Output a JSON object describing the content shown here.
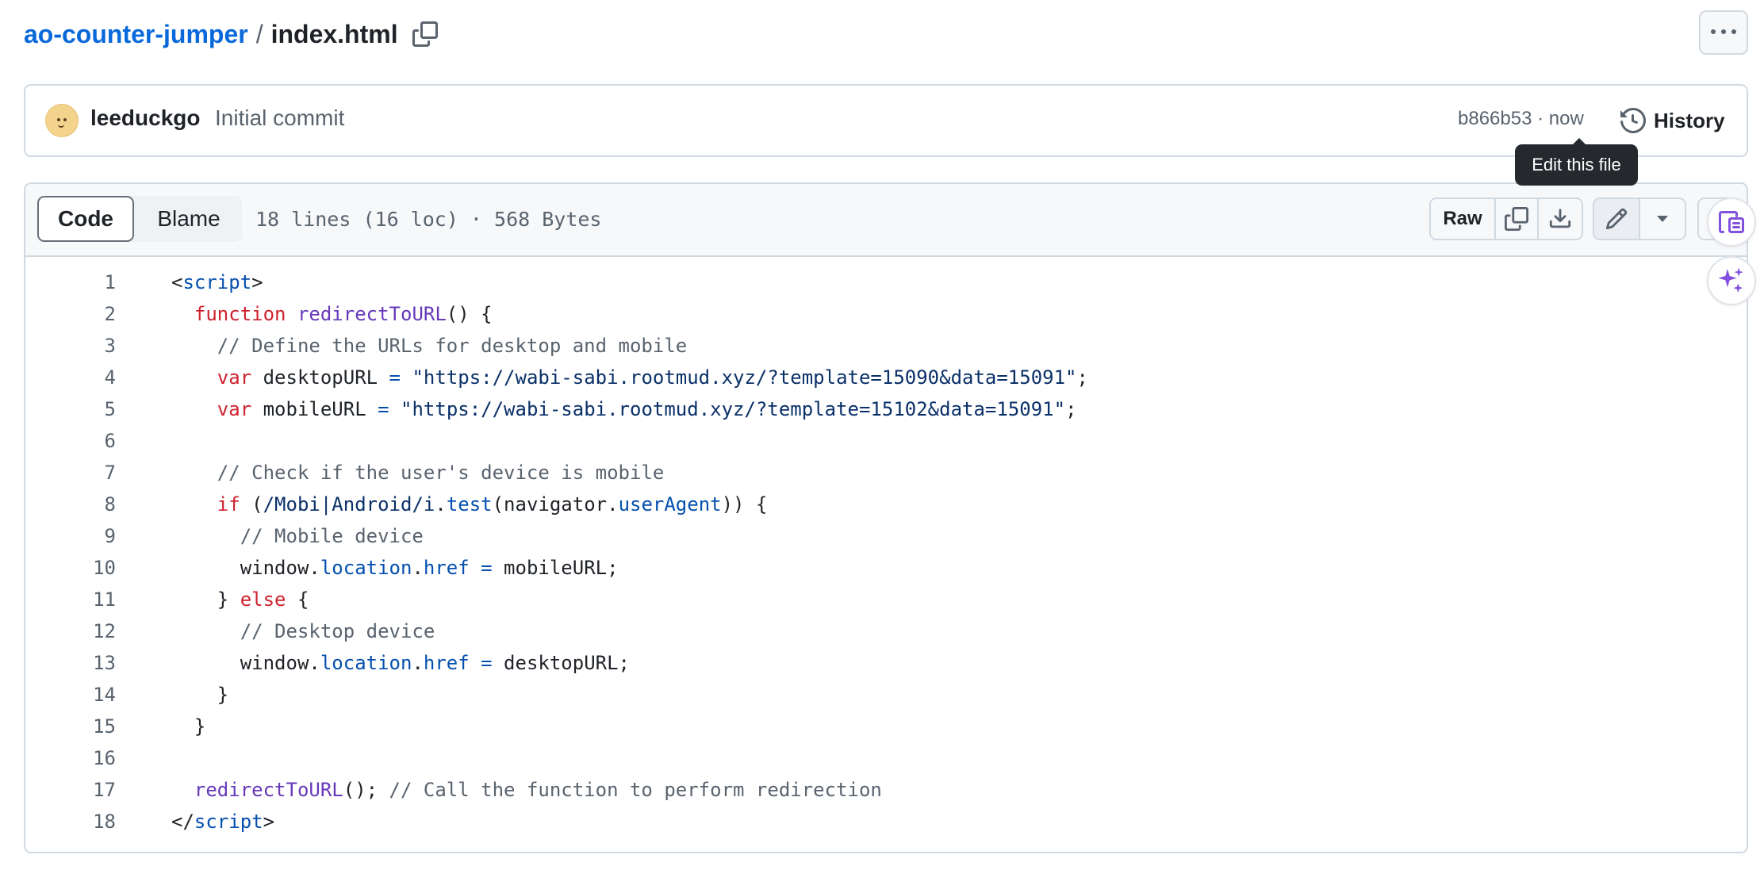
{
  "breadcrumb": {
    "repo": "ao-counter-jumper",
    "separator": "/",
    "file": "index.html"
  },
  "commit": {
    "author": "leeduckgo",
    "message": "Initial commit",
    "sha_time": "b866b53 · now",
    "history_label": "History"
  },
  "tooltip": "Edit this file",
  "file_header": {
    "tab_code": "Code",
    "tab_blame": "Blame",
    "info": "18 lines (16 loc) · 568 Bytes",
    "raw_label": "Raw"
  },
  "icons": [
    "copy-path-icon",
    "kebab-icon",
    "history-icon",
    "copy-icon",
    "download-icon",
    "pencil-icon",
    "caret-down-icon",
    "symbols-icon",
    "copilot-icon"
  ],
  "colors": {
    "link": "#0969da",
    "keyword": "#cf222e",
    "function": "#6639ba",
    "string": "#0a3069",
    "comment": "#59636e",
    "property": "#0550ae",
    "tooltip_bg": "#25292e"
  },
  "code_lines": [
    [
      {
        "t": "<",
        "c": "plain"
      },
      {
        "t": "script",
        "c": "prop"
      },
      {
        "t": ">",
        "c": "plain"
      }
    ],
    [
      {
        "t": "  ",
        "c": "plain"
      },
      {
        "t": "function",
        "c": "kw"
      },
      {
        "t": " ",
        "c": "plain"
      },
      {
        "t": "redirectToURL",
        "c": "fn"
      },
      {
        "t": "() {",
        "c": "plain"
      }
    ],
    [
      {
        "t": "    // Define the URLs for desktop and mobile",
        "c": "com"
      }
    ],
    [
      {
        "t": "    ",
        "c": "plain"
      },
      {
        "t": "var",
        "c": "kw"
      },
      {
        "t": " desktopURL ",
        "c": "plain"
      },
      {
        "t": "=",
        "c": "op"
      },
      {
        "t": " ",
        "c": "plain"
      },
      {
        "t": "\"https://wabi-sabi.rootmud.xyz/?template=15090&data=15091\"",
        "c": "str"
      },
      {
        "t": ";",
        "c": "plain"
      }
    ],
    [
      {
        "t": "    ",
        "c": "plain"
      },
      {
        "t": "var",
        "c": "kw"
      },
      {
        "t": " mobileURL ",
        "c": "plain"
      },
      {
        "t": "=",
        "c": "op"
      },
      {
        "t": " ",
        "c": "plain"
      },
      {
        "t": "\"https://wabi-sabi.rootmud.xyz/?template=15102&data=15091\"",
        "c": "str"
      },
      {
        "t": ";",
        "c": "plain"
      }
    ],
    [],
    [
      {
        "t": "    // Check if the user's device is mobile",
        "c": "com"
      }
    ],
    [
      {
        "t": "    ",
        "c": "plain"
      },
      {
        "t": "if",
        "c": "kw"
      },
      {
        "t": " (",
        "c": "plain"
      },
      {
        "t": "/Mobi|Android/i",
        "c": "str"
      },
      {
        "t": ".",
        "c": "plain"
      },
      {
        "t": "test",
        "c": "prop"
      },
      {
        "t": "(navigator.",
        "c": "plain"
      },
      {
        "t": "userAgent",
        "c": "prop"
      },
      {
        "t": ")) {",
        "c": "plain"
      }
    ],
    [
      {
        "t": "      // Mobile device",
        "c": "com"
      }
    ],
    [
      {
        "t": "      window.",
        "c": "plain"
      },
      {
        "t": "location",
        "c": "prop"
      },
      {
        "t": ".",
        "c": "plain"
      },
      {
        "t": "href",
        "c": "prop"
      },
      {
        "t": " ",
        "c": "plain"
      },
      {
        "t": "=",
        "c": "op"
      },
      {
        "t": " mobileURL;",
        "c": "plain"
      }
    ],
    [
      {
        "t": "    } ",
        "c": "plain"
      },
      {
        "t": "else",
        "c": "kw"
      },
      {
        "t": " {",
        "c": "plain"
      }
    ],
    [
      {
        "t": "      // Desktop device",
        "c": "com"
      }
    ],
    [
      {
        "t": "      window.",
        "c": "plain"
      },
      {
        "t": "location",
        "c": "prop"
      },
      {
        "t": ".",
        "c": "plain"
      },
      {
        "t": "href",
        "c": "prop"
      },
      {
        "t": " ",
        "c": "plain"
      },
      {
        "t": "=",
        "c": "op"
      },
      {
        "t": " desktopURL;",
        "c": "plain"
      }
    ],
    [
      {
        "t": "    }",
        "c": "plain"
      }
    ],
    [
      {
        "t": "  }",
        "c": "plain"
      }
    ],
    [],
    [
      {
        "t": "  ",
        "c": "plain"
      },
      {
        "t": "redirectToURL",
        "c": "fn"
      },
      {
        "t": "(); ",
        "c": "plain"
      },
      {
        "t": "// Call the function to perform redirection",
        "c": "com"
      }
    ],
    [
      {
        "t": "</",
        "c": "plain"
      },
      {
        "t": "script",
        "c": "prop"
      },
      {
        "t": ">",
        "c": "plain"
      }
    ]
  ]
}
